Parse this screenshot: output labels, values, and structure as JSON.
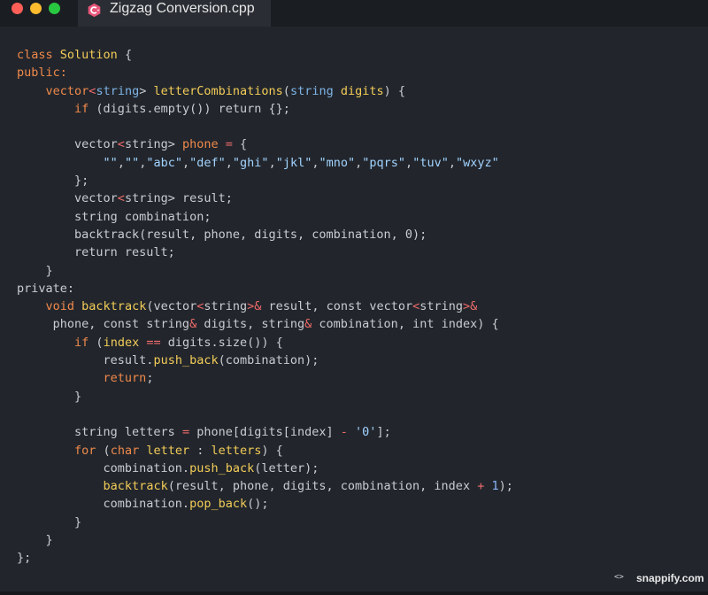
{
  "tab": {
    "filename": "Zigzag Conversion.cpp",
    "icon": "cpp-icon"
  },
  "window_controls": [
    "close",
    "minimize",
    "maximize"
  ],
  "colors": {
    "keyword": "#f0894b",
    "type": "#7fb3e6",
    "function": "#f3cc58",
    "string": "#a2d3ff",
    "number": "#8ab4f8",
    "operator": "#f06b6b",
    "text": "#c9ccd1",
    "background": "#22262c"
  },
  "code": {
    "lines": [
      [
        [
          "kw",
          "class"
        ],
        [
          "t",
          " "
        ],
        [
          "fn",
          "Solution"
        ],
        [
          "t",
          " {"
        ]
      ],
      [
        [
          "kw",
          "public:"
        ]
      ],
      [
        [
          "t",
          "    "
        ],
        [
          "kw",
          "vector"
        ],
        [
          "op",
          "<"
        ],
        [
          "type",
          "string"
        ],
        [
          "t",
          "> "
        ],
        [
          "fn",
          "letterCombinations"
        ],
        [
          "t",
          "("
        ],
        [
          "type",
          "string"
        ],
        [
          "t",
          " "
        ],
        [
          "fn",
          "digits"
        ],
        [
          "t",
          ") {"
        ]
      ],
      [
        [
          "t",
          "        "
        ],
        [
          "kw",
          "if"
        ],
        [
          "t",
          " (digits.empty()) return {};"
        ]
      ],
      [
        [
          "t",
          ""
        ]
      ],
      [
        [
          "t",
          "        vector"
        ],
        [
          "op",
          "<"
        ],
        [
          "t",
          "string> "
        ],
        [
          "kw",
          "phone"
        ],
        [
          "t",
          " "
        ],
        [
          "op",
          "="
        ],
        [
          "t",
          " {"
        ]
      ],
      [
        [
          "t",
          "            "
        ],
        [
          "str",
          "\"\""
        ],
        [
          "t",
          ","
        ],
        [
          "str",
          "\"\""
        ],
        [
          "t",
          ","
        ],
        [
          "str",
          "\"abc\""
        ],
        [
          "t",
          ","
        ],
        [
          "str",
          "\"def\""
        ],
        [
          "t",
          ","
        ],
        [
          "str",
          "\"ghi\""
        ],
        [
          "t",
          ","
        ],
        [
          "str",
          "\"jkl\""
        ],
        [
          "t",
          ","
        ],
        [
          "str",
          "\"mno\""
        ],
        [
          "t",
          ","
        ],
        [
          "str",
          "\"pqrs\""
        ],
        [
          "t",
          ","
        ],
        [
          "str",
          "\"tuv\""
        ],
        [
          "t",
          ","
        ],
        [
          "str",
          "\"wxyz\""
        ]
      ],
      [
        [
          "t",
          "        };"
        ]
      ],
      [
        [
          "t",
          "        vector"
        ],
        [
          "op",
          "<"
        ],
        [
          "t",
          "string> result;"
        ]
      ],
      [
        [
          "t",
          "        string combination;"
        ]
      ],
      [
        [
          "t",
          "        backtrack(result, phone, digits, combination, 0);"
        ]
      ],
      [
        [
          "t",
          "        return result;"
        ]
      ],
      [
        [
          "t",
          "    }"
        ]
      ],
      [
        [
          "t",
          "private:"
        ]
      ],
      [
        [
          "t",
          "    "
        ],
        [
          "kw",
          "void"
        ],
        [
          "t",
          " "
        ],
        [
          "fn",
          "backtrack"
        ],
        [
          "t",
          "(vector"
        ],
        [
          "op",
          "<"
        ],
        [
          "t",
          "string"
        ],
        [
          "op",
          ">&"
        ],
        [
          "t",
          " result, const vector"
        ],
        [
          "op",
          "<"
        ],
        [
          "t",
          "string"
        ],
        [
          "op",
          ">&"
        ]
      ],
      [
        [
          "t",
          "     phone, const string"
        ],
        [
          "op",
          "&"
        ],
        [
          "t",
          " digits, string"
        ],
        [
          "op",
          "&"
        ],
        [
          "t",
          " combination, int index) {"
        ]
      ],
      [
        [
          "t",
          "        "
        ],
        [
          "kw",
          "if"
        ],
        [
          "t",
          " ("
        ],
        [
          "fn",
          "index"
        ],
        [
          "t",
          " "
        ],
        [
          "op",
          "=="
        ],
        [
          "t",
          " digits.size()) {"
        ]
      ],
      [
        [
          "t",
          "            result."
        ],
        [
          "fn",
          "push_back"
        ],
        [
          "t",
          "(combination);"
        ]
      ],
      [
        [
          "t",
          "            "
        ],
        [
          "kw",
          "return"
        ],
        [
          "t",
          ";"
        ]
      ],
      [
        [
          "t",
          "        }"
        ]
      ],
      [
        [
          "t",
          ""
        ]
      ],
      [
        [
          "t",
          "        string letters "
        ],
        [
          "op",
          "="
        ],
        [
          "t",
          " phone[digits[index] "
        ],
        [
          "op",
          "-"
        ],
        [
          "t",
          " "
        ],
        [
          "str",
          "'0'"
        ],
        [
          "t",
          "];"
        ]
      ],
      [
        [
          "t",
          "        "
        ],
        [
          "kw",
          "for"
        ],
        [
          "t",
          " ("
        ],
        [
          "kw",
          "char"
        ],
        [
          "t",
          " "
        ],
        [
          "fn",
          "letter"
        ],
        [
          "t",
          " : "
        ],
        [
          "fn",
          "letters"
        ],
        [
          "t",
          ") {"
        ]
      ],
      [
        [
          "t",
          "            combination."
        ],
        [
          "fn",
          "push_back"
        ],
        [
          "t",
          "(letter);"
        ]
      ],
      [
        [
          "t",
          "            "
        ],
        [
          "fn",
          "backtrack"
        ],
        [
          "t",
          "(result, phone, digits, combination, index "
        ],
        [
          "op",
          "+"
        ],
        [
          "t",
          " "
        ],
        [
          "num",
          "1"
        ],
        [
          "t",
          ");"
        ]
      ],
      [
        [
          "t",
          "            combination."
        ],
        [
          "fn",
          "pop_back"
        ],
        [
          "t",
          "();"
        ]
      ],
      [
        [
          "t",
          "        }"
        ]
      ],
      [
        [
          "t",
          "    }"
        ]
      ],
      [
        [
          "t",
          "};"
        ]
      ]
    ]
  },
  "brand": {
    "label": "snappify.com",
    "icon_glyph": "<>"
  }
}
